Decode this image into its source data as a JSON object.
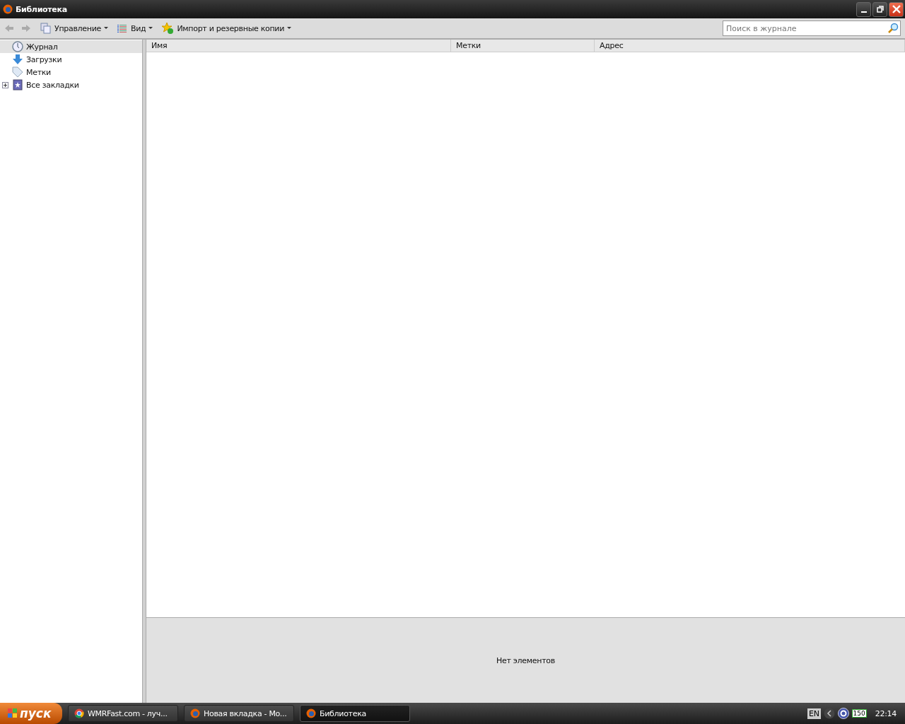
{
  "window": {
    "title": "Библиотека"
  },
  "toolbar": {
    "menus": [
      {
        "label": "Управление",
        "kind": "organize"
      },
      {
        "label": "Вид",
        "kind": "views"
      },
      {
        "label": "Импорт и резервные копии",
        "kind": "import"
      }
    ],
    "search": {
      "placeholder": "Поиск в журнале"
    }
  },
  "sidebar": {
    "items": [
      {
        "label": "Журнал",
        "kind": "history",
        "selected": true
      },
      {
        "label": "Загрузки",
        "kind": "downloads",
        "selected": false
      },
      {
        "label": "Метки",
        "kind": "tags",
        "selected": false
      },
      {
        "label": "Все закладки",
        "kind": "bookmarks",
        "selected": false,
        "expanded": false
      }
    ]
  },
  "table": {
    "columns": [
      "Имя",
      "Метки",
      "Адрес"
    ]
  },
  "details": {
    "message": "Нет элементов"
  },
  "taskbar": {
    "start": "пуск",
    "tasks": [
      {
        "label": "WMRFast.com - луч...",
        "kind": "chrome",
        "selected": false
      },
      {
        "label": "Новая вкладка - Mo...",
        "kind": "firefox",
        "selected": false
      },
      {
        "label": "Библиотека",
        "kind": "firefox",
        "selected": true
      }
    ],
    "tray": {
      "language": "EN",
      "badge": "150",
      "clock": "22:14"
    }
  }
}
